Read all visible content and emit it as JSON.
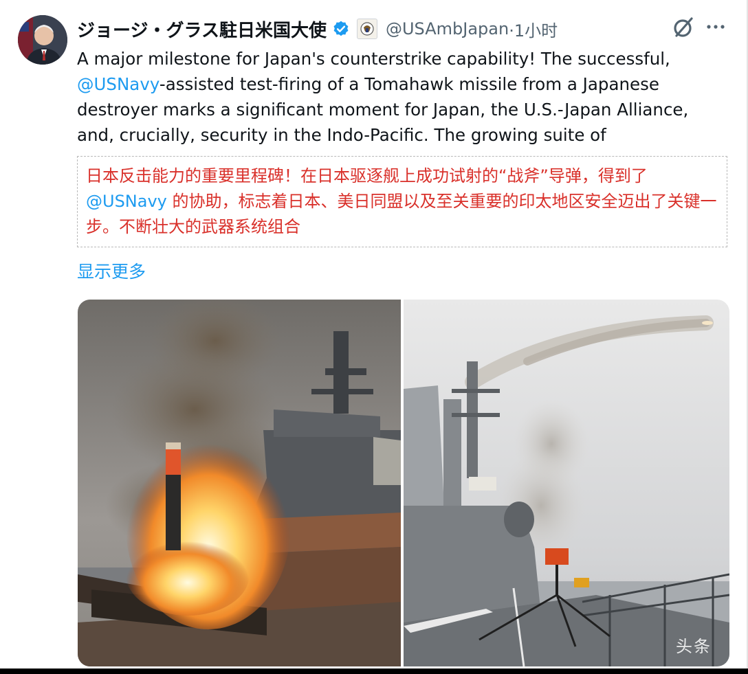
{
  "author": {
    "display_name": "ジョージ・グラス駐日米国大使",
    "handle": "@USAmbJapan",
    "time": "·1小时"
  },
  "icons": {
    "verified": "verified-badge-icon",
    "affiliation": "embassy-seal-icon",
    "grok": "grok-icon",
    "more": "more-options-icon"
  },
  "tweet": {
    "seg1": "A major milestone for Japan's counterstrike capability! The successful, ",
    "mention": "@USNavy",
    "seg2": "-assisted test-firing of a Tomahawk missile from a Japanese destroyer marks a significant moment for Japan, the U.S.-Japan Alliance, and, crucially, security in the Indo-Pacific. The growing suite of"
  },
  "translation": {
    "seg1": "日本反击能力的重要里程碑！在日本驱逐舰上成功试射的“战斧”导弹，得到了 ",
    "mention": "@USNavy",
    "seg2": " 的协助，标志着日本、美日同盟以及至关重要的印太地区安全迈出了关键一步。不断壮大的武器系统组合"
  },
  "show_more": "显示更多",
  "media": {
    "watermark": "头条"
  },
  "colors": {
    "link": "#1d9bf0",
    "translation_text": "#d9302a",
    "verified": "#1d9bf0"
  }
}
